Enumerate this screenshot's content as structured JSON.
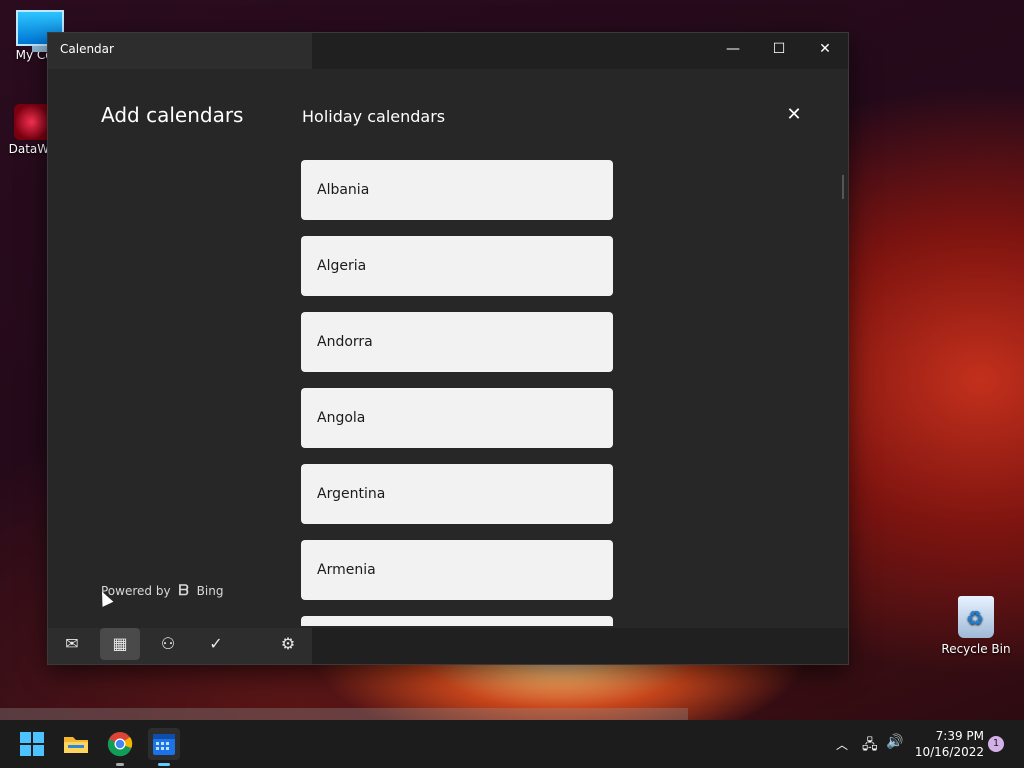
{
  "desktop": {
    "icons": [
      {
        "label": "My Com"
      },
      {
        "label": "DataWag"
      },
      {
        "label": "Recycle Bin"
      }
    ]
  },
  "window": {
    "title": "Calendar",
    "controls": {
      "minimize": "—",
      "maximize": "☐",
      "close": "✕"
    }
  },
  "panel": {
    "heading": "Add calendars",
    "subheading": "Holiday calendars",
    "close_glyph": "✕",
    "countries": [
      "Albania",
      "Algeria",
      "Andorra",
      "Angola",
      "Argentina",
      "Armenia",
      ""
    ],
    "powered_by": "Powered by",
    "powered_brand": "Bing"
  },
  "nav": {
    "items": [
      {
        "name": "mail",
        "icon": "mail-icon",
        "glyph": "✉"
      },
      {
        "name": "calendar",
        "icon": "calendar-icon",
        "glyph": "▦"
      },
      {
        "name": "people",
        "icon": "people-icon",
        "glyph": "⚇"
      },
      {
        "name": "todo",
        "icon": "todo-icon",
        "glyph": "✓"
      },
      {
        "name": "settings",
        "icon": "settings-icon",
        "glyph": "⚙"
      }
    ],
    "active": "calendar"
  },
  "taskbar": {
    "clock_time": "7:39 PM",
    "clock_date": "10/16/2022",
    "notification_count": "1"
  },
  "colors": {
    "accent": "#60cdff",
    "window_bg": "#272727",
    "card_bg": "#f2f2f2"
  }
}
